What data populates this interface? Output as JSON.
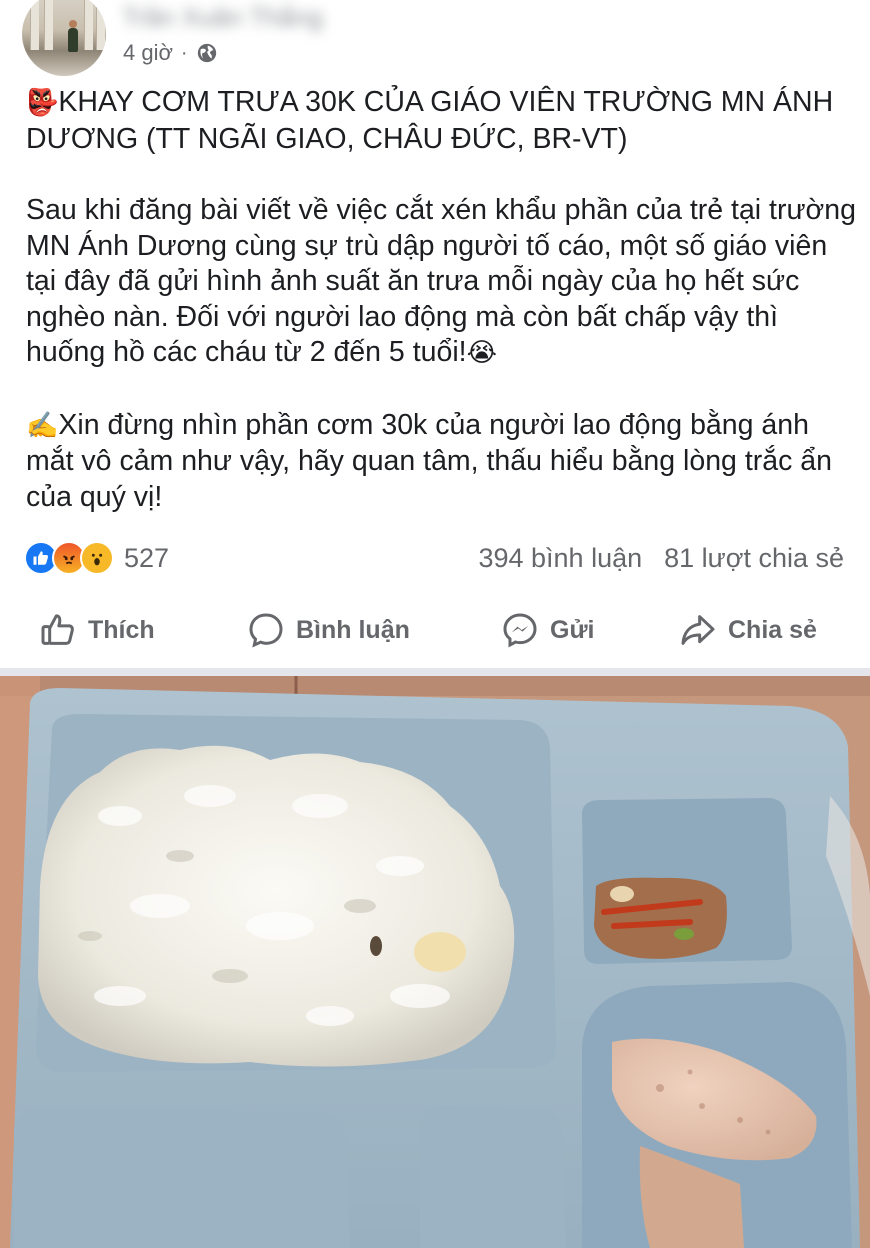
{
  "post": {
    "author_name": "Trần Xuân Thắng",
    "time": "4 giờ",
    "separator": "·",
    "privacy_icon": "globe-icon",
    "title_emoji": "👺",
    "title": "KHAY CƠM TRƯA 30K CỦA GIÁO VIÊN TRƯỜNG MN ÁNH DƯƠNG (TT NGÃI GIAO, CHÂU ĐỨC, BR-VT)",
    "paragraph1": "Sau khi đăng bài viết về việc cắt xén khẩu phần của trẻ tại trường MN Ánh Dương cùng sự trù dập người tố cáo, một số giáo viên tại đây đã gửi hình ảnh suất ăn trưa mỗi ngày của họ hết sức nghèo nàn. Đối với người lao động mà còn bất chấp vậy thì huống hồ các cháu từ 2 đến 5 tuổi!",
    "paragraph1_emoji": "😭",
    "paragraph2_emoji": "✍️",
    "paragraph2": "Xin đừng nhìn phần cơm 30k của người lao động bằng ánh mắt vô cảm như vậy, hãy quan tâm, thấu hiểu bằng lòng trắc ẩn của quý vị!"
  },
  "reactions": {
    "icons": [
      "like-icon",
      "angry-icon",
      "wow-icon"
    ],
    "count": "527",
    "comments": "394 bình luận",
    "shares": "81 lượt chia sẻ"
  },
  "actions": {
    "like": "Thích",
    "comment": "Bình luận",
    "send": "Gửi",
    "share": "Chia sẻ"
  },
  "colors": {
    "text": "#1c1e21",
    "secondary": "#65676b",
    "like_blue": "#1877f2",
    "divider": "#e4e6eb"
  }
}
